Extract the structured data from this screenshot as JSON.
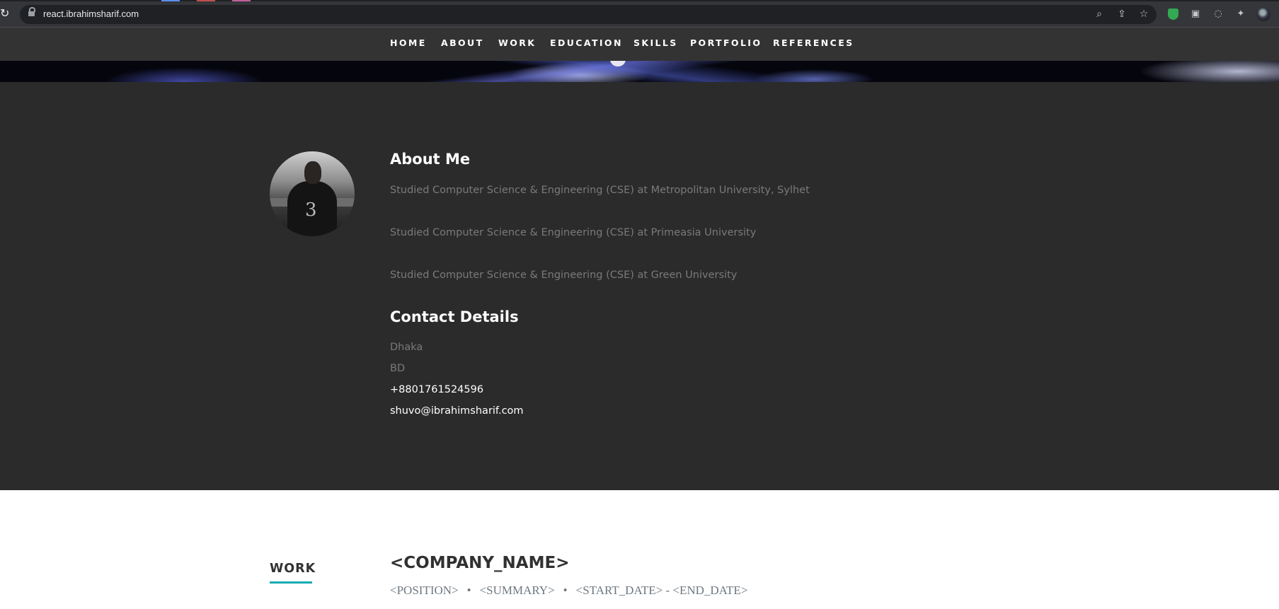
{
  "browser": {
    "url": "react.ibrahimsharif.com",
    "tab_accent_colors": [
      "#5b8def",
      "#c0504d",
      "#c0609a"
    ]
  },
  "nav": {
    "items": [
      "HOME",
      "ABOUT",
      "WORK",
      "EDUCATION",
      "SKILLS",
      "PORTFOLIO",
      "REFERENCES"
    ]
  },
  "about": {
    "title": "About Me",
    "bio": [
      "Studied Computer Science & Engineering (CSE) at Metropolitan University, Sylhet",
      "Studied Computer Science & Engineering (CSE) at Primeasia University",
      "Studied Computer Science & Engineering (CSE) at Green University"
    ],
    "profile_pic_number": "3"
  },
  "contact": {
    "title": "Contact Details",
    "city": "Dhaka",
    "country": "BD",
    "phone": "+8801761524596",
    "email": "shuvo@ibrahimsharif.com"
  },
  "work": {
    "heading": "WORK",
    "company": "<COMPANY_NAME>",
    "position": "<POSITION>",
    "bullet": "•",
    "summary": "<SUMMARY>",
    "dates": "<START_DATE> - <END_DATE>"
  },
  "colors": {
    "accent": "#11abb0",
    "about_bg": "#2b2b2b",
    "nav_bg": "#333333"
  }
}
